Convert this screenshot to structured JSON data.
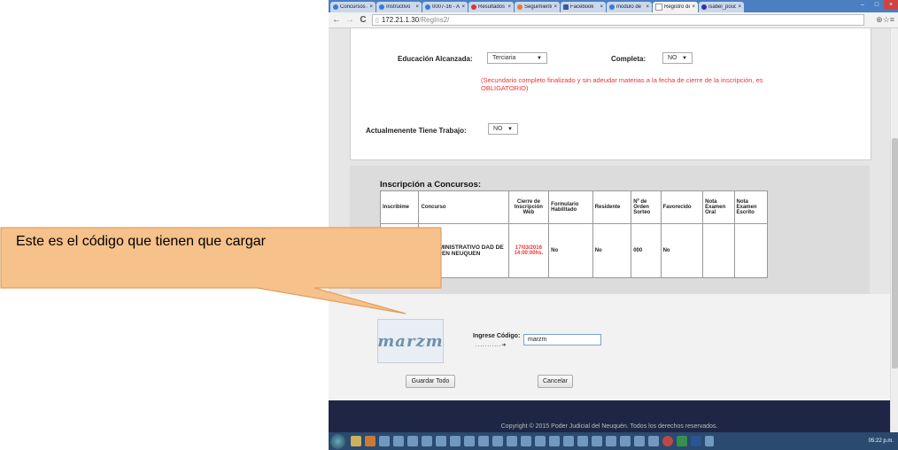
{
  "browser": {
    "tabs": [
      {
        "label": "Concursos J"
      },
      {
        "label": "Instructivo"
      },
      {
        "label": "0007-16 - Al"
      },
      {
        "label": "Resultados"
      },
      {
        "label": "Seguimiento"
      },
      {
        "label": "Facebook"
      },
      {
        "label": "modulo de"
      },
      {
        "label": "Registro de I",
        "active": true
      },
      {
        "label": "isabel_pouch"
      }
    ],
    "address_host": "172.21.1.30",
    "address_path": "/RegIns2/"
  },
  "form": {
    "educacion_label": "Educación Alcanzada:",
    "educacion_value": "Terciaria",
    "completa_label": "Completa:",
    "completa_value": "NO",
    "warning": "(Secundario completo finalizado y sin adeudar materias a la fecha de cierre de la inscripción, es OBLIGATORIO)",
    "trabajo_label": "Actualmenente Tiene Trabajo:",
    "trabajo_value": "NO"
  },
  "inscripcion": {
    "title": "Inscripción a Concursos:",
    "headers": [
      "Inscribime",
      "Concurso",
      "Cierre de Inscripción Web",
      "Formulario Habilitado",
      "Residente",
      "Nº de Orden Sorteo",
      "Favorecido",
      "Nota Examen Oral",
      "Nota Examen Escrito"
    ],
    "row": {
      "inscribime": "",
      "concurso": "AR ADMINISTRATIVO DAD DE NEUQUEN NEUQUEN",
      "cierre": "17/03/2016 14:00:00hs.",
      "formulario": "No",
      "residente": "No",
      "orden": "000",
      "favorecido": "No",
      "oral": "",
      "escrito": ""
    }
  },
  "captcha": {
    "image_text": "marzm",
    "label": "Ingrese Código:",
    "arrow": "...........➔",
    "input_value": "marzm"
  },
  "buttons": {
    "guardar": "Guardar Todo",
    "cancelar": "Cancelar"
  },
  "footer": {
    "text": "Copyright © 2015 Poder Judicial del Neuquén. Todos los derechos reservados."
  },
  "taskbar": {
    "clock": "05:22 p.m."
  },
  "callout": {
    "text": "Este es el código que tienen que cargar",
    "fill": "#f6c18a",
    "stroke": "#e0a060"
  }
}
